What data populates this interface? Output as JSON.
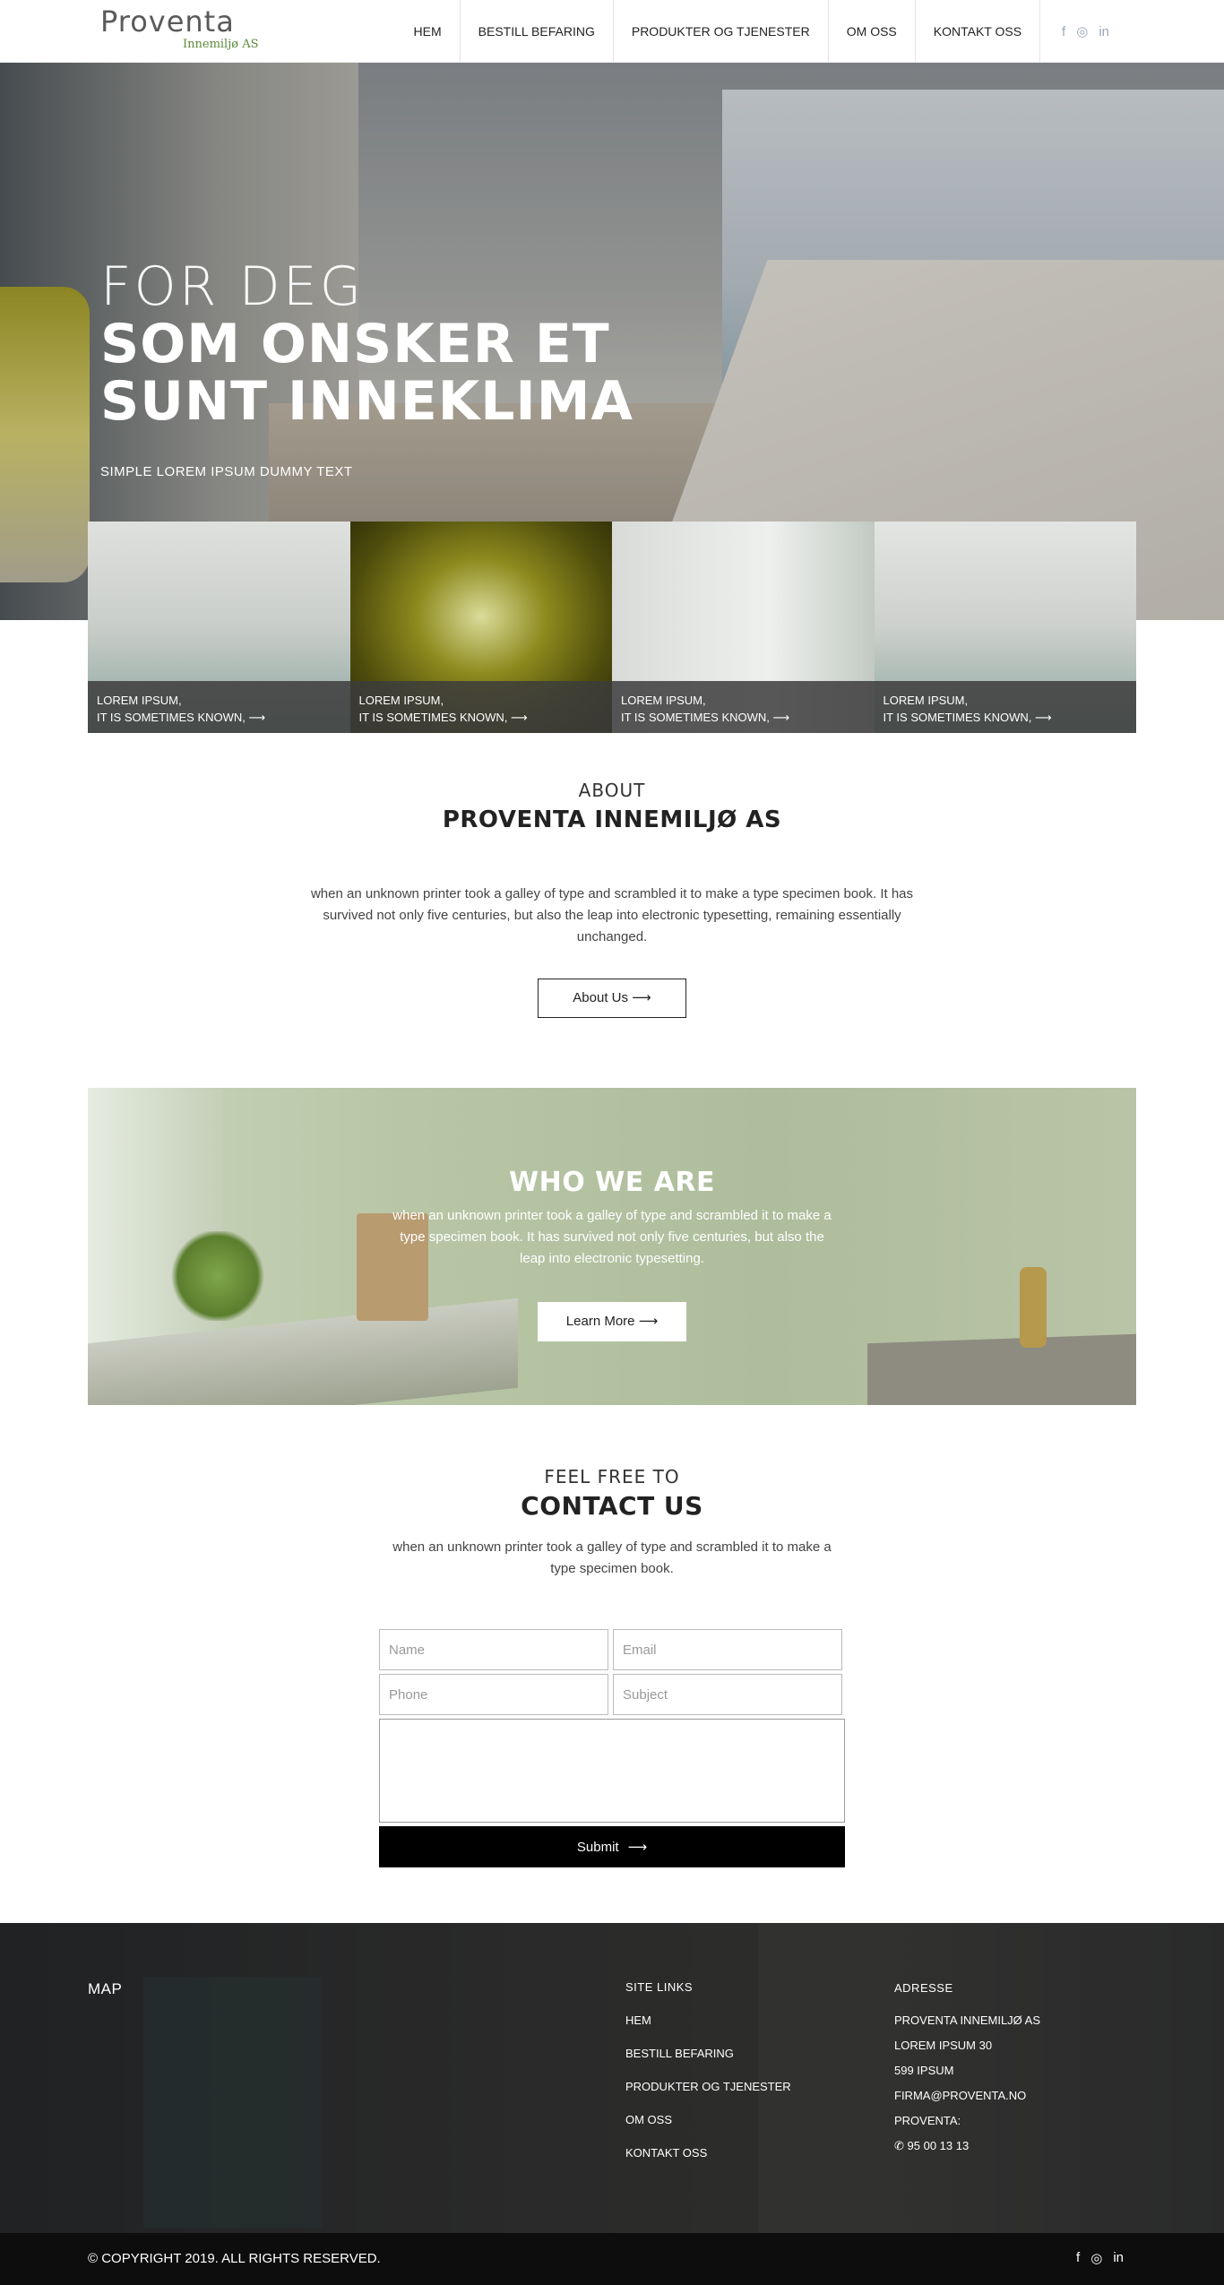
{
  "header": {
    "logo_main": "Proventa",
    "logo_sub": "Innemiljø AS",
    "nav": [
      "HEM",
      "BESTILL BEFARING",
      "PRODUKTER OG TJENESTER",
      "OM OSS",
      "KONTAKT OSS"
    ],
    "social": [
      "f",
      "◎",
      "in"
    ]
  },
  "hero": {
    "line1": "FOR DEG",
    "line2": "SOM ONSKER ET",
    "line3": "SUNT INNEKLIMA",
    "sub": "SIMPLE LOREM IPSUM DUMMY TEXT"
  },
  "tiles": [
    {
      "line1": "LOREM IPSUM,",
      "line2": "IT IS SOMETIMES KNOWN,"
    },
    {
      "line1": "LOREM IPSUM,",
      "line2": "IT IS SOMETIMES KNOWN,"
    },
    {
      "line1": "LOREM IPSUM,",
      "line2": "IT IS SOMETIMES KNOWN,"
    },
    {
      "line1": "LOREM IPSUM,",
      "line2": "IT IS SOMETIMES KNOWN,"
    }
  ],
  "about": {
    "eyebrow": "ABOUT",
    "title": "PROVENTA INNEMILJØ AS",
    "text": "when an unknown printer took a galley of type and scrambled it to make a type specimen book. It has survived not only five centuries, but also the leap into electronic typesetting, remaining essentially unchanged.",
    "button": "About Us"
  },
  "who": {
    "title": "WHO WE ARE",
    "text": "when an unknown printer took a galley of type and scrambled it to make a type specimen book. It has survived not only five centuries, but also the leap into electronic typesetting.",
    "button": "Learn More"
  },
  "contact": {
    "eyebrow": "FEEL FREE TO",
    "title": "CONTACT US",
    "text": "when an unknown printer took a galley of type and scrambled it to make a type specimen book.",
    "placeholders": {
      "name": "Name",
      "email": "Email",
      "phone": "Phone",
      "subject": "Subject"
    },
    "submit": "Submit"
  },
  "footer": {
    "map_head": "MAP",
    "links_head": "SITE LINKS",
    "links": [
      "HEM",
      "BESTILL BEFARING",
      "PRODUKTER OG TJENESTER",
      "OM OSS",
      "KONTAKT OSS"
    ],
    "addr_head": "ADRESSE",
    "addr": [
      "PROVENTA INNEMILJØ AS",
      "LOREM IPSUM 30",
      "599 IPSUM",
      "FIRMA@PROVENTA.NO",
      "PROVENTA:"
    ],
    "phone": "95 00 13 13",
    "copyright": "© COPYRIGHT 2019. ALL RIGHTS RESERVED."
  },
  "colors": {
    "accent_green": "#5a8a3a",
    "dark": "#0d0d0d"
  }
}
